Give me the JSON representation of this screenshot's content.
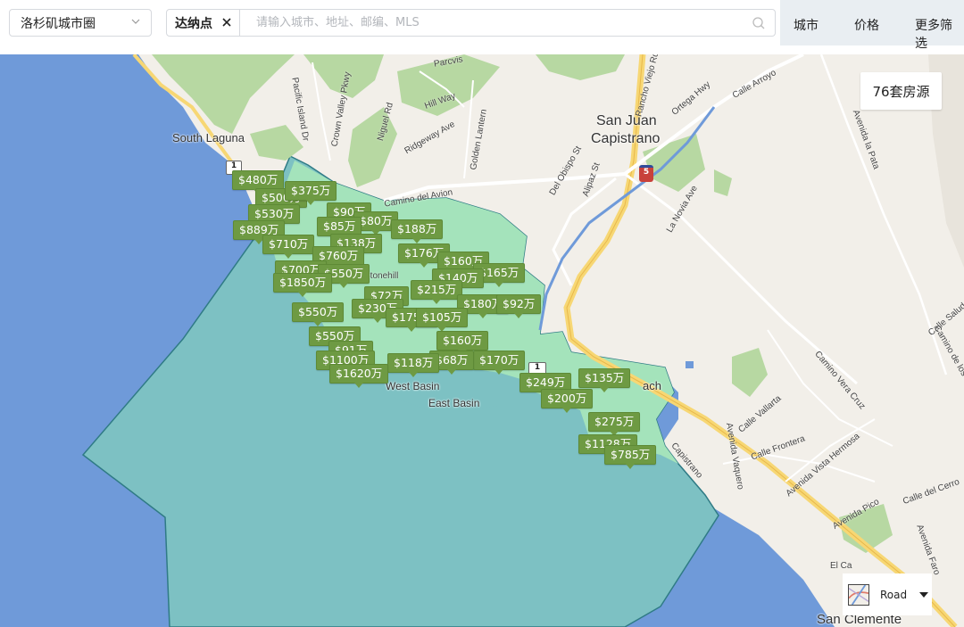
{
  "topbar": {
    "region_select": "洛杉矶城市圈",
    "tag_label": "达纳点",
    "search_placeholder": "请输入城市、地址、邮编、MLS",
    "filters": [
      "城市",
      "价格",
      "更多筛选"
    ]
  },
  "map": {
    "listing_count": "76套房源",
    "map_type": "Road",
    "place_labels": [
      "South Laguna",
      "San Juan",
      "Capistrano",
      "West Basin",
      "East Basin",
      "San Clemente"
    ],
    "street_labels": [
      "Pacific Island Dr",
      "Crown Valley Pkwy",
      "Niguel Rd",
      "Parcvis",
      "Golden Lantern",
      "Hill Way",
      "Ridgeway Ave",
      "Rancho Viejo Rd",
      "Ortega Hwy",
      "Calle Arroyo",
      "Del Obispo St",
      "Alipaz St",
      "La Novia Ave",
      "Avenida la Pata",
      "Camino Vera Cruz",
      "Calle Vallarta",
      "Calle Frontera",
      "Avenida Vista Hermosa",
      "Avenida Pico",
      "Calle del Cerro",
      "Calle Saluda",
      "Avenida Faro",
      "Camino de los Mares",
      "Avenida Vaquero",
      "El Ca",
      "Capistrano",
      "Camino del Avion",
      "Stonehill",
      "ach"
    ],
    "route_shields": [
      "1",
      "5",
      "1"
    ],
    "price_pins": [
      "$480万",
      "$500万",
      "$375万",
      "$530万",
      "$90万",
      "$80万",
      "$889万",
      "$85万",
      "$188万",
      "$710万",
      "$138万",
      "$176万",
      "$760万",
      "$160万",
      "$700万",
      "$550万",
      "$165万",
      "$1850万",
      "$140万",
      "$215万",
      "$72万",
      "$180万",
      "$92万",
      "$550万",
      "$230万",
      "$175万",
      "$105万",
      "$550万",
      "$160万",
      "$91万",
      "$170万",
      "$68万",
      "$1100万",
      "$118万",
      "$1620万",
      "$249万",
      "$135万",
      "$200万",
      "$275万",
      "$1128万",
      "$785万"
    ],
    "colors": {
      "ocean": "#6f9ad9",
      "boundary_fill": "#a4e3bb",
      "park": "#b7d8a2",
      "pin": "#6e9a43",
      "land": "#f2efe9"
    }
  }
}
